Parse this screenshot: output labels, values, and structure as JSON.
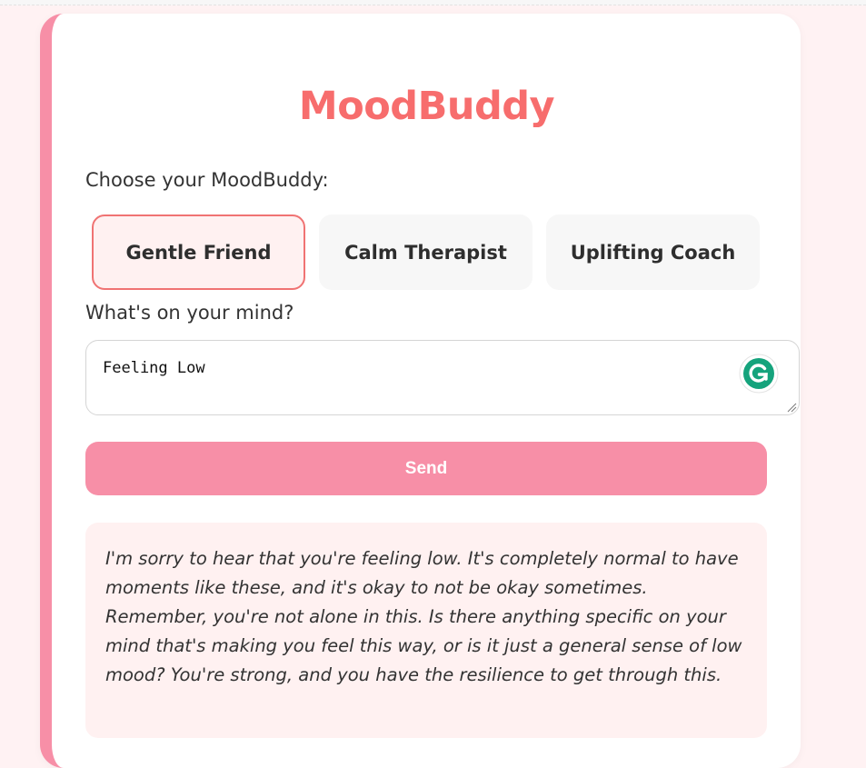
{
  "app": {
    "title": "MoodBuddy"
  },
  "persona_section": {
    "label": "Choose your MoodBuddy:",
    "options": [
      {
        "label": "Gentle Friend",
        "selected": true
      },
      {
        "label": "Calm Therapist",
        "selected": false
      },
      {
        "label": "Uplifting Coach",
        "selected": false
      }
    ]
  },
  "input_section": {
    "label": "What's on your mind?",
    "value": "Feeling Low",
    "extension_icon": "grammarly-icon"
  },
  "send": {
    "label": "Send"
  },
  "response": {
    "text": "I'm sorry to hear that you're feeling low. It's completely normal to have moments like these, and it's okay to not be okay sometimes. Remember, you're not alone in this. Is there anything specific on your mind that's making you feel this way, or is it just a general sense of low mood? You're strong, and you have the resilience to get through this."
  },
  "colors": {
    "accent": "#f76d6d",
    "primary_pink": "#f78fa7",
    "background": "#fff2f3",
    "response_bg": "#fff1f1",
    "grammarly_green": "#15a37c"
  }
}
